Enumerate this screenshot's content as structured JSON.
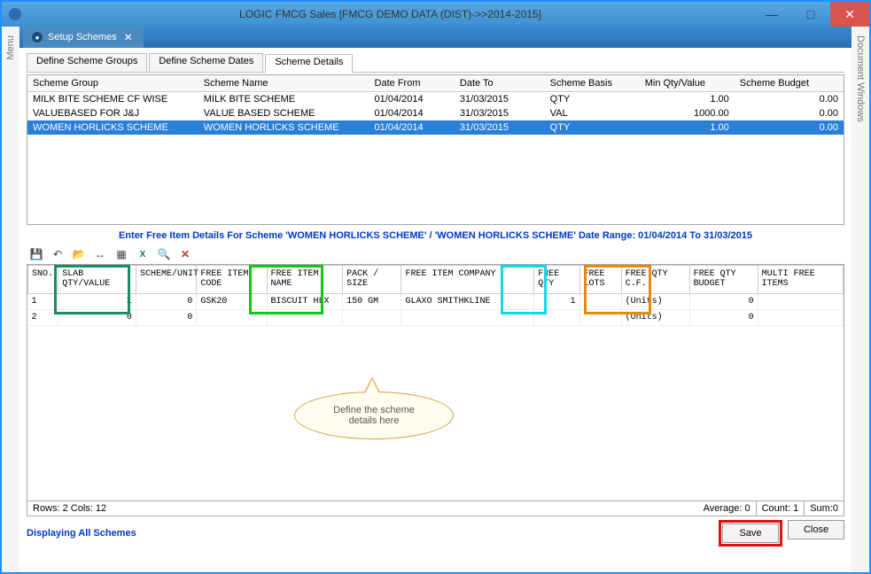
{
  "window": {
    "title": "LOGIC FMCG Sales  [FMCG DEMO DATA (DIST)->>2014-2015]",
    "minimize": "—",
    "maximize": "□",
    "close": "✕",
    "left_panel": "Menu",
    "right_panel": "Document Windows"
  },
  "docTab": {
    "label": "Setup Schemes",
    "close": "✕"
  },
  "subTabs": {
    "t1": "Define Scheme Groups",
    "t2": "Define Scheme Dates",
    "t3": "Scheme Details"
  },
  "grid1": {
    "headers": {
      "c1": "Scheme Group",
      "c2": "Scheme Name",
      "c3": "Date From",
      "c4": "Date To",
      "c5": "Scheme Basis",
      "c6": "Min Qty/Value",
      "c7": "Scheme Budget"
    },
    "rows": [
      {
        "c1": "MILK BITE SCHEME CF WISE",
        "c2": "MILK BITE SCHEME",
        "c3": "01/04/2014",
        "c4": "31/03/2015",
        "c5": "QTY",
        "c6": "1.00",
        "c7": "0.00"
      },
      {
        "c1": "VALUEBASED FOR J&J",
        "c2": "VALUE BASED SCHEME",
        "c3": "01/04/2014",
        "c4": "31/03/2015",
        "c5": "VAL",
        "c6": "1000.00",
        "c7": "0.00"
      },
      {
        "c1": "WOMEN HORLICKS SCHEME",
        "c2": "WOMEN HORLICKS SCHEME",
        "c3": "01/04/2014",
        "c4": "31/03/2015",
        "c5": "QTY",
        "c6": "1.00",
        "c7": "0.00"
      }
    ]
  },
  "instruction": "Enter Free Item Details For Scheme 'WOMEN HORLICKS SCHEME' / 'WOMEN HORLICKS SCHEME'  Date Range: 01/04/2014 To 31/03/2015",
  "toolbar": {
    "save": "💾",
    "undo": "↶",
    "open": "📂",
    "fit": "↔",
    "grid": "▦",
    "excel": "X",
    "find": "🔍",
    "delete": "✕"
  },
  "grid2": {
    "headers": {
      "c1": "SNO.",
      "c2": "SLAB QTY/VALUE",
      "c3": "SCHEME/UNIT",
      "c4": "FREE ITEM CODE",
      "c5": "FREE ITEM NAME",
      "c6": "PACK / SIZE",
      "c7": "FREE ITEM COMPANY",
      "c8": "FREE QTY",
      "c9": "FREE LOTS",
      "c10": "FREE QTY C.F.",
      "c11": "FREE QTY BUDGET",
      "c12": "MULTI FREE ITEMS"
    },
    "rows": [
      {
        "c1": "1",
        "c2": "1",
        "c3": "0",
        "c4": "GSK20",
        "c5": "BISCUIT HLX",
        "c6": "150 GM",
        "c7": "GLAXO SMITHKLINE",
        "c8": "1",
        "c9": "",
        "c10": "(Units)",
        "c11": "0",
        "c12": ""
      },
      {
        "c1": "2",
        "c2": "0",
        "c3": "0",
        "c4": "",
        "c5": "",
        "c6": "",
        "c7": "",
        "c8": "",
        "c9": "",
        "c10": "(Units)",
        "c11": "0",
        "c12": ""
      }
    ]
  },
  "callout": "Define the scheme details here",
  "status": {
    "rows_cols": "Rows: 2  Cols: 12",
    "avg": "Average: 0",
    "count": "Count: 1",
    "sum": "Sum:0"
  },
  "footer": {
    "displaying": "Displaying All Schemes",
    "save": "Save",
    "close": "Close"
  }
}
